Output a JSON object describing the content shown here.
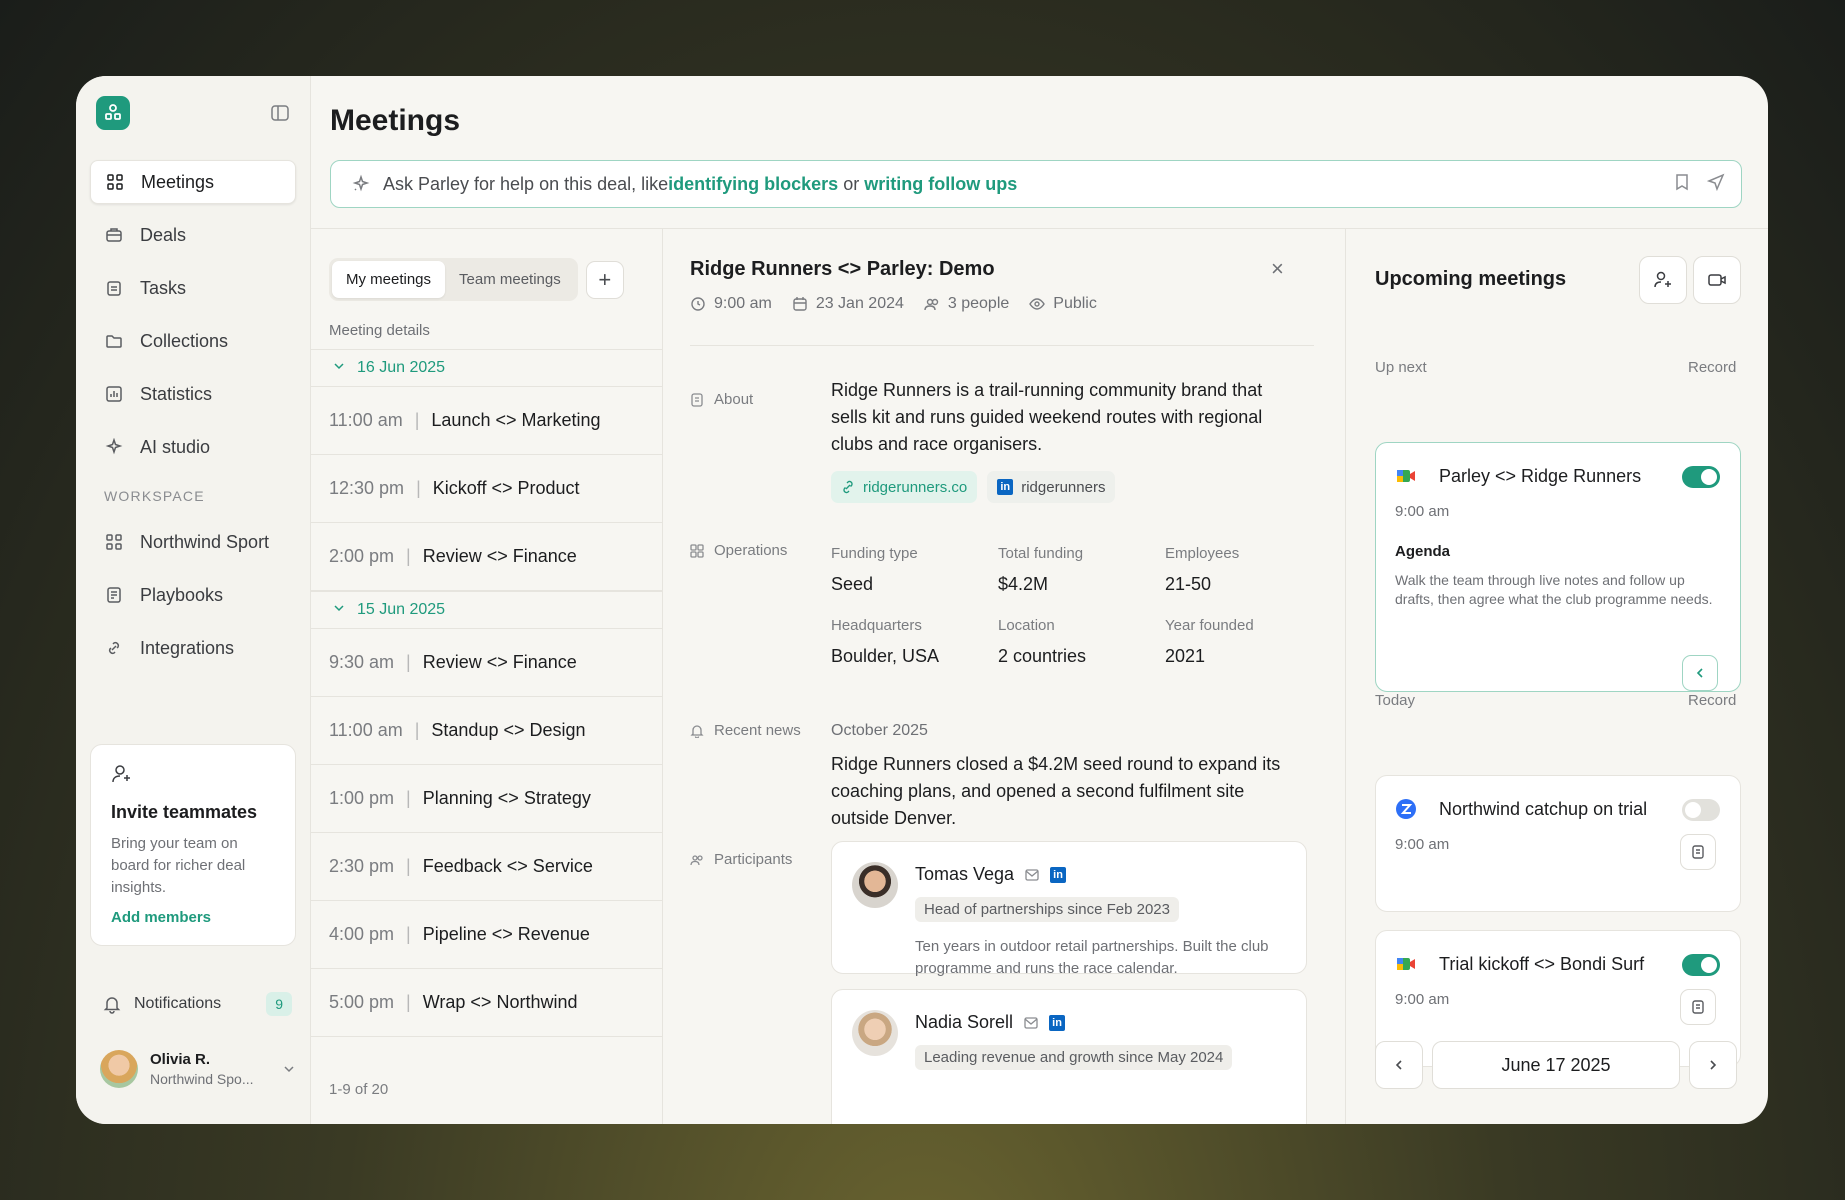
{
  "sidebar": {
    "nav": [
      {
        "label": "Meetings",
        "icon": "grid-icon"
      },
      {
        "label": "Deals",
        "icon": "briefcase-icon"
      },
      {
        "label": "Tasks",
        "icon": "clipboard-icon"
      },
      {
        "label": "Collections",
        "icon": "folder-icon"
      },
      {
        "label": "Statistics",
        "icon": "chart-icon"
      },
      {
        "label": "AI studio",
        "icon": "sparkle-icon"
      }
    ],
    "workspace_label": "WORKSPACE",
    "workspace": [
      {
        "label": "Northwind Sport",
        "icon": "grid-icon"
      },
      {
        "label": "Playbooks",
        "icon": "document-icon"
      },
      {
        "label": "Integrations",
        "icon": "link-icon"
      }
    ],
    "invite": {
      "title": "Invite teammates",
      "desc": "Bring your team on board for richer deal insights.",
      "link": "Add members"
    },
    "notifications": {
      "label": "Notifications",
      "count": "9"
    },
    "user": {
      "name": "Olivia R.",
      "org": "Northwind Spo..."
    }
  },
  "header": {
    "title": "Meetings",
    "ask": {
      "prefix": "Ask Parley for help on this deal, like ",
      "link1": "identifying blockers",
      "mid": " or ",
      "link2": "writing follow ups"
    }
  },
  "list": {
    "tabs": [
      "My meetings",
      "Team meetings"
    ],
    "label": "Meeting details",
    "groups": [
      {
        "date": "16 Jun 2025",
        "items": [
          {
            "time": "11:00 am",
            "title": "Launch <> Marketing"
          },
          {
            "time": "12:30 pm",
            "title": "Kickoff <> Product"
          },
          {
            "time": "2:00 pm",
            "title": "Review <> Finance"
          }
        ]
      },
      {
        "date": "15 Jun 2025",
        "items": [
          {
            "time": "9:30 am",
            "title": "Review <> Finance"
          },
          {
            "time": "11:00 am",
            "title": "Standup <> Design"
          },
          {
            "time": "1:00 pm",
            "title": "Planning <> Strategy"
          },
          {
            "time": "2:30 pm",
            "title": "Feedback <> Service"
          },
          {
            "time": "4:00 pm",
            "title": "Pipeline <> Revenue"
          },
          {
            "time": "5:00 pm",
            "title": "Wrap <> Northwind"
          }
        ]
      }
    ],
    "pager": "1-9 of 20"
  },
  "detail": {
    "title": "Ridge Runners <> Parley: Demo",
    "time": "9:00 am",
    "date": "23 Jan 2024",
    "people": "3 people",
    "visibility": "Public",
    "about_label": "About",
    "about": "Ridge Runners is a trail-running community brand that sells kit and runs guided weekend routes with regional clubs and race organisers.",
    "website": "ridgerunners.co",
    "linkedin": "ridgerunners",
    "ops_label": "Operations",
    "ops": [
      {
        "k": "Funding type",
        "v": "Seed"
      },
      {
        "k": "Total funding",
        "v": "$4.2M"
      },
      {
        "k": "Employees",
        "v": "21-50"
      },
      {
        "k": "Headquarters",
        "v": "Boulder, USA"
      },
      {
        "k": "Location",
        "v": "2 countries"
      },
      {
        "k": "Year founded",
        "v": "2021"
      }
    ],
    "news_label": "Recent news",
    "news_date": "October 2025",
    "news": "Ridge Runners closed a $4.2M seed round to expand its coaching plans, and opened a second fulfilment site outside Denver.",
    "participants_label": "Participants",
    "participants": [
      {
        "name": "Tomas Vega",
        "role": "Head of partnerships since Feb 2023",
        "bio": "Ten years in outdoor retail partnerships. Built the club programme and runs the race calendar."
      },
      {
        "name": "Nadia Sorell",
        "role": "Leading revenue and growth since May 2024",
        "bio": ""
      }
    ]
  },
  "upcoming": {
    "title": "Upcoming meetings",
    "up_next_label": "Up next",
    "record_label": "Record",
    "today_label": "Today",
    "next": {
      "title": "Parley <> Ridge Runners",
      "time": "9:00 am",
      "agenda_title": "Agenda",
      "agenda": "Walk the team through live notes and follow up drafts, then agree what the club programme needs.",
      "record": true
    },
    "today": [
      {
        "title": "Northwind catchup on trial",
        "time": "9:00 am",
        "app": "zoom-icon",
        "record": false
      },
      {
        "title": "Trial kickoff <> Bondi Surf",
        "time": "9:00 am",
        "app": "google-meet-icon",
        "record": true
      }
    ],
    "date": "June 17 2025"
  },
  "colors": {
    "accent": "#1f9a7d",
    "accent_light": "#9fd5c3"
  }
}
